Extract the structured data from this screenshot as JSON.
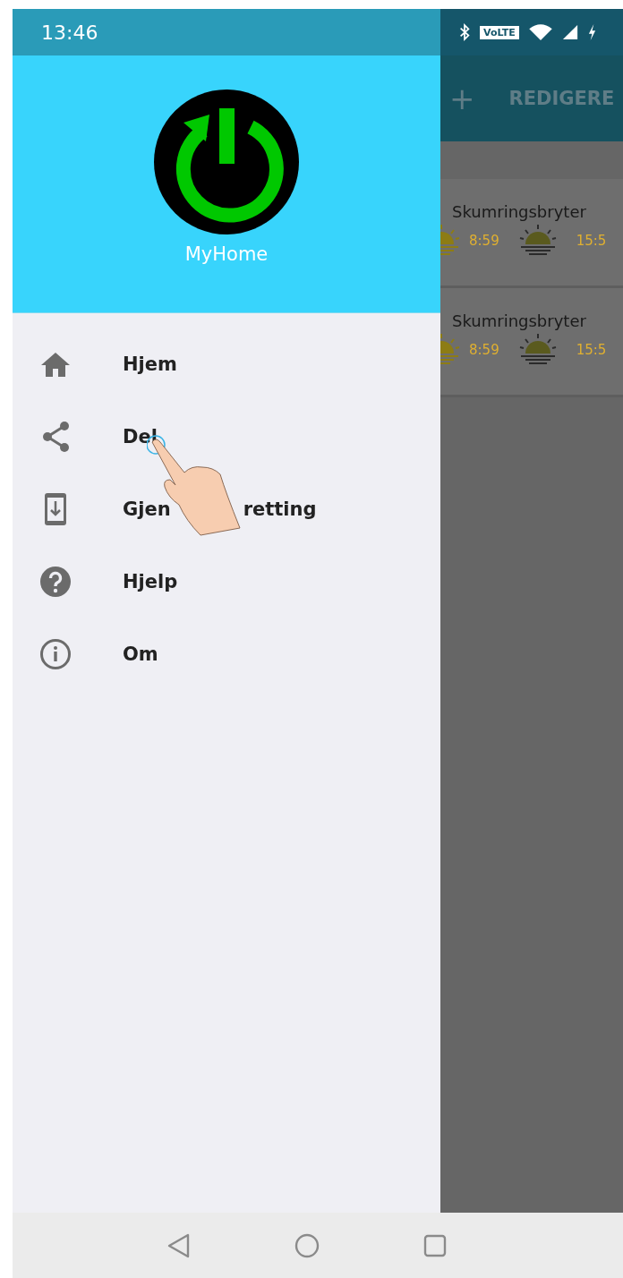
{
  "status_bar": {
    "time": "13:46",
    "volte_badge": "VoLTE"
  },
  "drawer": {
    "app_name": "MyHome",
    "items": [
      {
        "kind": "home",
        "label_parts": [
          "Hjem"
        ]
      },
      {
        "kind": "share",
        "label_parts": [
          "Del"
        ]
      },
      {
        "kind": "restore",
        "label_parts": [
          "Gjen",
          "retting"
        ]
      },
      {
        "kind": "help",
        "label_parts": [
          "Hjelp"
        ]
      },
      {
        "kind": "info",
        "label_parts": [
          "Om"
        ]
      }
    ]
  },
  "toolbar": {
    "add": "+",
    "edit": "REDIGERE"
  },
  "cards": [
    {
      "title": "Skumringsbryter",
      "sunrise": "8:59",
      "sunset": "15:5"
    },
    {
      "title": "Skumringsbryter",
      "sunrise": "8:59",
      "sunset": "15:5"
    }
  ]
}
